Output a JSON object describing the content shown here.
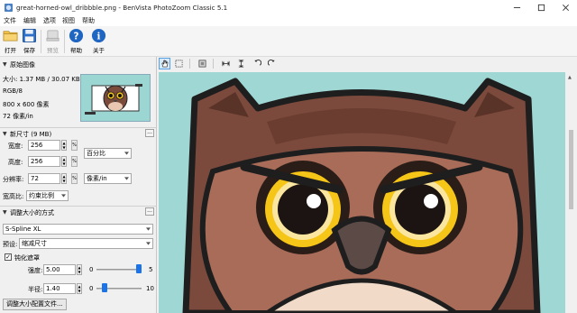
{
  "window": {
    "title": "great-horned-owl_dribbble.png - BenVista PhotoZoom Classic 5.1"
  },
  "menu": [
    "文件",
    "编辑",
    "选项",
    "视图",
    "帮助"
  ],
  "toolbar": {
    "open": "打开",
    "save": "保存",
    "preview": "预览",
    "help": "帮助",
    "about": "关于"
  },
  "original": {
    "header": "原始图像",
    "size": "大小: 1.37 MB / 30.07 KB",
    "mode": "RGB/8",
    "dims": "800 x 600 像素",
    "dpi": "72 像素/in"
  },
  "newsize": {
    "header": "新尺寸 (9 MB)",
    "width_label": "宽度:",
    "width_value": "256",
    "height_label": "高度:",
    "height_value": "256",
    "percent_unit": "百分比",
    "res_label": "分辨率:",
    "res_value": "72",
    "res_unit": "像素/in",
    "ratio_label": "宽高比:",
    "ratio_value": "约束比例"
  },
  "method": {
    "header": "调整大小的方式",
    "algorithm": "S-Spline XL",
    "preset_label": "预设:",
    "preset_value": "缩减尺寸",
    "sharpen_label": "钝化遮罩",
    "amount_label": "强度:",
    "amount_value": "5.00",
    "amount_min": "0",
    "amount_max": "5",
    "amount_level": 1.0,
    "radius_label": "半径:",
    "radius_value": "1.40",
    "radius_min": "0",
    "radius_max": "10",
    "radius_level": 0.14,
    "profile_button": "调整大小配置文件..."
  },
  "colors": {
    "canvas": "#9ed7d3",
    "accent": "#1a73e8"
  }
}
